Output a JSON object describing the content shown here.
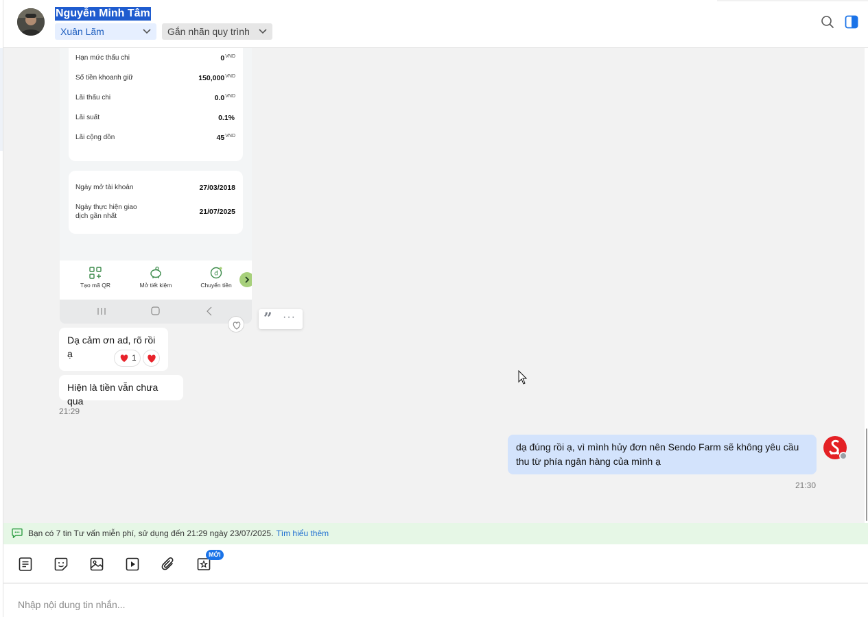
{
  "header": {
    "contact_name": "Nguyễn Minh Tâm",
    "staff_select": "Xuân Lãm",
    "tag_select": "Gắn nhãn quy trình",
    "icons": [
      "search-icon",
      "side-panel-icon",
      "chevron-down-icon"
    ]
  },
  "screenshot": {
    "rows1": [
      {
        "label": "Hạn mức thấu chi",
        "value": "0",
        "unit": "VND"
      },
      {
        "label": "Số tiền khoanh giữ",
        "value": "150,000",
        "unit": "VND"
      },
      {
        "label": "Lãi thấu chi",
        "value": "0.0",
        "unit": "VND"
      },
      {
        "label": "Lãi suất",
        "value": "0.1%",
        "unit": ""
      },
      {
        "label": "Lãi cộng dồn",
        "value": "45",
        "unit": "VND"
      }
    ],
    "rows2": [
      {
        "label": "Ngày mở tài khoản",
        "value": "27/03/2018"
      },
      {
        "label": "Ngày thực hiện giao dịch gần nhất",
        "value": "21/07/2025"
      }
    ],
    "nav": [
      "Tạo mã QR",
      "Mở tiết kiệm",
      "Chuyển tiền"
    ]
  },
  "messages": {
    "in_1": "Dạ cảm ơn ad, rõ rồi ạ",
    "in_1_reaction_count": "1",
    "in_2": "Hiện là tiền vẫn chưa qua",
    "in_time": "21:29",
    "out_1": "dạ đúng rồi ạ, vì mình hủy đơn nên Sendo Farm sẽ không yêu cầu thu từ phía ngân hàng của mình ạ",
    "out_time": "21:30"
  },
  "notice": {
    "text": "Bạn có 7 tin Tư vấn miễn phí, sử dụng đến 21:29 ngày 23/07/2025.",
    "link": "Tìm hiểu thêm"
  },
  "toolbar": {
    "new_badge": "MỚI",
    "icons": [
      "note-icon",
      "sticker-icon",
      "image-icon",
      "video-icon",
      "attachment-icon",
      "star-template-icon"
    ]
  },
  "composer": {
    "placeholder": "Nhập nội dung tin nhắn..."
  },
  "colors": {
    "accent": "#1f5ccf",
    "outgoing_bubble": "#d3e3fc",
    "notice_bg": "#e6f7e6",
    "brand_red": "#e42125"
  }
}
